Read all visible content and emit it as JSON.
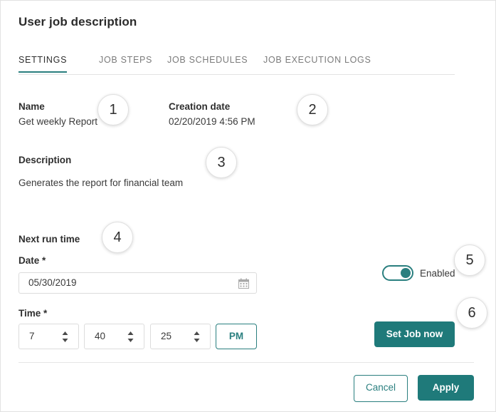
{
  "window": {
    "title": "User job description"
  },
  "tabs": [
    {
      "label": "SETTINGS",
      "active": true
    },
    {
      "label": "JOB STEPS",
      "active": false
    },
    {
      "label": "JOB SCHEDULES",
      "active": false
    },
    {
      "label": "JOB EXECUTION LOGS",
      "active": false
    }
  ],
  "fields": {
    "name": {
      "label": "Name",
      "value": "Get weekly Report"
    },
    "creation_date": {
      "label": "Creation date",
      "value": "02/20/2019 4:56 PM"
    },
    "description": {
      "label": "Description",
      "value": "Generates the report for financial team"
    },
    "next_run_time": {
      "label": "Next run time"
    },
    "date": {
      "label": "Date *",
      "value": "05/30/2019",
      "icon": "calendar-icon"
    },
    "time": {
      "label": "Time *",
      "hour": "7",
      "minute": "40",
      "second": "25",
      "ampm": "PM"
    }
  },
  "toggle": {
    "label": "Enabled",
    "state": "on"
  },
  "buttons": {
    "set_job_now": "Set Job now",
    "cancel": "Cancel",
    "apply": "Apply"
  },
  "badges": [
    "1",
    "2",
    "3",
    "4",
    "5",
    "6"
  ],
  "colors": {
    "accent_teal": "#2a7f7f",
    "primary_button": "#1f7a7a",
    "label_text": "#2f2f2f",
    "value_text": "#3a3a3a",
    "muted_tab": "#7b7b7b",
    "border": "#dcdcdc"
  }
}
